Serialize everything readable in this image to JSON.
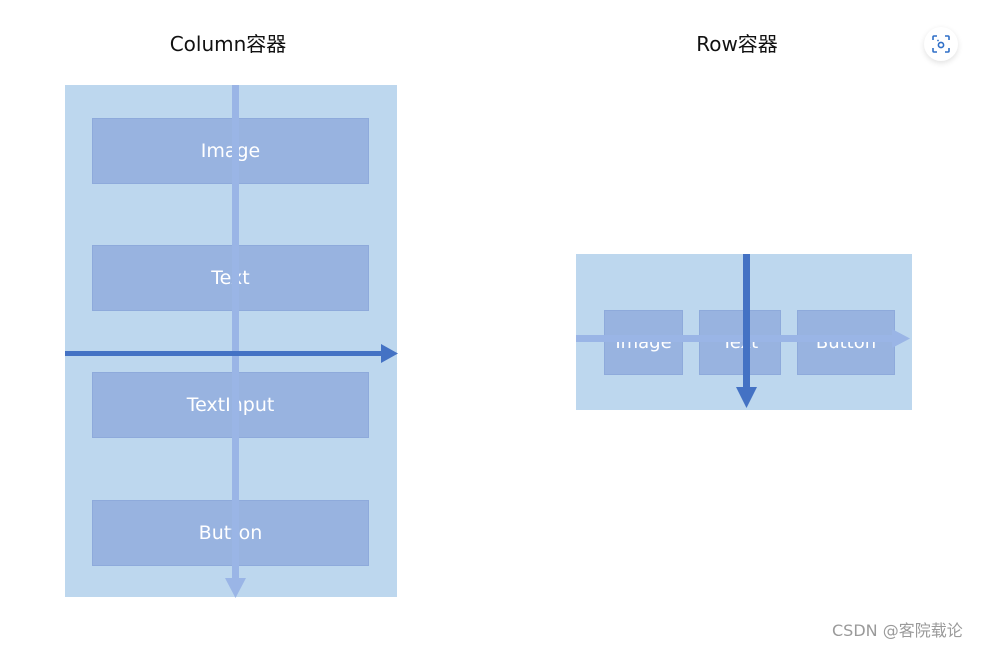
{
  "column_panel": {
    "title": "Column容器",
    "children": [
      "Image",
      "Text",
      "TextInput",
      "Button"
    ],
    "main_axis": "vertical",
    "cross_axis": "horizontal"
  },
  "row_panel": {
    "title": "Row容器",
    "children": [
      "Image",
      "Text",
      "Button"
    ],
    "main_axis": "horizontal",
    "cross_axis": "vertical"
  },
  "colors": {
    "container_bg": "#bdd7ee",
    "child_fill": "#98b3e0",
    "child_border": "#8eaadb",
    "main_axis_arrow": "#9ab5e6",
    "cross_axis_arrow": "#4472c4"
  },
  "toolbar": {
    "scan_icon": "scan-icon"
  },
  "watermark": "CSDN @客院载论"
}
